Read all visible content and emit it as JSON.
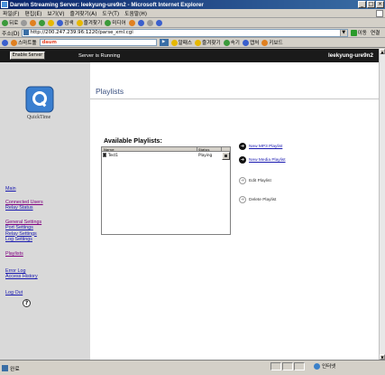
{
  "window": {
    "title": "Darwin Streaming Server: leekyung-ure9n2 - Microsoft Internet Explorer",
    "controls": [
      "_",
      "□",
      "×"
    ]
  },
  "menubar": {
    "items": [
      "파일(F)",
      "편집(E)",
      "보기(V)",
      "즐겨찾기(A)",
      "도구(T)",
      "도움말(H)"
    ]
  },
  "toolbar": {
    "back": "뒤로",
    "search": "검색",
    "favorites": "즐겨찾기",
    "media": "미디어"
  },
  "addressbar": {
    "label": "주소(D)",
    "url": "http://200.247.239.96:1220/parse_xml.cgi",
    "go": "이동",
    "links": "연결"
  },
  "linkbar": {
    "smart": "스마트툴",
    "search_brand": "daum",
    "buttons": [
      "알패스",
      "즐겨찾기",
      "속기",
      "캡처",
      "키보드"
    ]
  },
  "page": {
    "enable_button": "Enable Server",
    "server_status": "Server is Running",
    "hostname": "leekyung-ure9n2",
    "logo_text": "QuickTime",
    "nav_groups": [
      [
        "Main"
      ],
      [
        "Connected Users",
        "Relay Status"
      ],
      [
        "General Settings",
        "Port Settings",
        "Relay Settings",
        "Log Settings"
      ],
      [
        "Playlists"
      ],
      [
        "Error Log",
        "Access History"
      ],
      [
        "Log Out"
      ]
    ],
    "help_icon": "?",
    "content_title": "Playlists",
    "available_title": "Available Playlists:",
    "table": {
      "headers": [
        "Name",
        "Status"
      ],
      "rows": [
        {
          "name": "Test1",
          "status": "Playing"
        }
      ]
    },
    "actions": {
      "new_mp3": "New MP3 Playlist",
      "new_media": "New Media Playlist",
      "edit": "Edit Playlist",
      "delete": "Delete Playlist"
    }
  },
  "statusbar": {
    "left": "완료",
    "zone": "인터넷"
  },
  "colors": {
    "titlebar_start": "#0a246a",
    "titlebar_end": "#3a6ea5",
    "dark_header": "#1a1a1a",
    "sidebar_bg": "#d9d9d9",
    "link": "#1a1ab0",
    "title_blue": "#3a5080"
  }
}
